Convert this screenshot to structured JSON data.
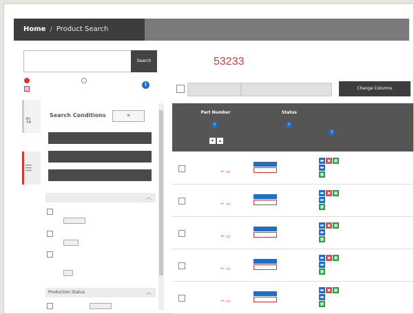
{
  "header": {
    "home": "Home",
    "separator": "/",
    "current": "Product Search"
  },
  "search": {
    "placeholder": "",
    "button_label": "Search",
    "opt_starting": "",
    "opt_including": "",
    "opt_realtime": ""
  },
  "conditions": {
    "title": "Search Conditions",
    "close_label": "",
    "buttons": [
      "",
      "",
      ""
    ],
    "sections": [
      {
        "title": "",
        "items": [
          {
            "label": "",
            "count": ""
          },
          {
            "label": "",
            "count": ""
          },
          {
            "label": "",
            "count": ""
          }
        ]
      },
      {
        "title": "Production Status",
        "items": [
          {
            "label": "",
            "count": ""
          }
        ]
      }
    ]
  },
  "results": {
    "breadcrumb": "",
    "applicable_label": "",
    "count": "53233",
    "results_word": "",
    "compare_label": "",
    "selected_label": "",
    "change_columns_label": "Change Columns"
  },
  "table": {
    "columns": [
      "Part Number",
      "Status",
      "",
      ""
    ],
    "rows": [
      {
        "part": "",
        "status_a": "",
        "status_b": "",
        "category": ""
      },
      {
        "part": "",
        "status_a": "",
        "status_b": "",
        "category": ""
      },
      {
        "part": "",
        "status_a": "",
        "status_b": "",
        "category": ""
      },
      {
        "part": "",
        "status_a": "",
        "status_b": "",
        "category": ""
      },
      {
        "part": "",
        "status_a": "",
        "status_b": "",
        "category": ""
      }
    ]
  },
  "colors": {
    "accent": "#d33333",
    "header_dark": "#3d3d3d",
    "info_blue": "#1e6fc7"
  },
  "icons": [
    "info-icon",
    "filter-icon",
    "list-icon",
    "close-icon",
    "caret-up-icon",
    "pdf-icon",
    "spreadsheet-icon"
  ]
}
